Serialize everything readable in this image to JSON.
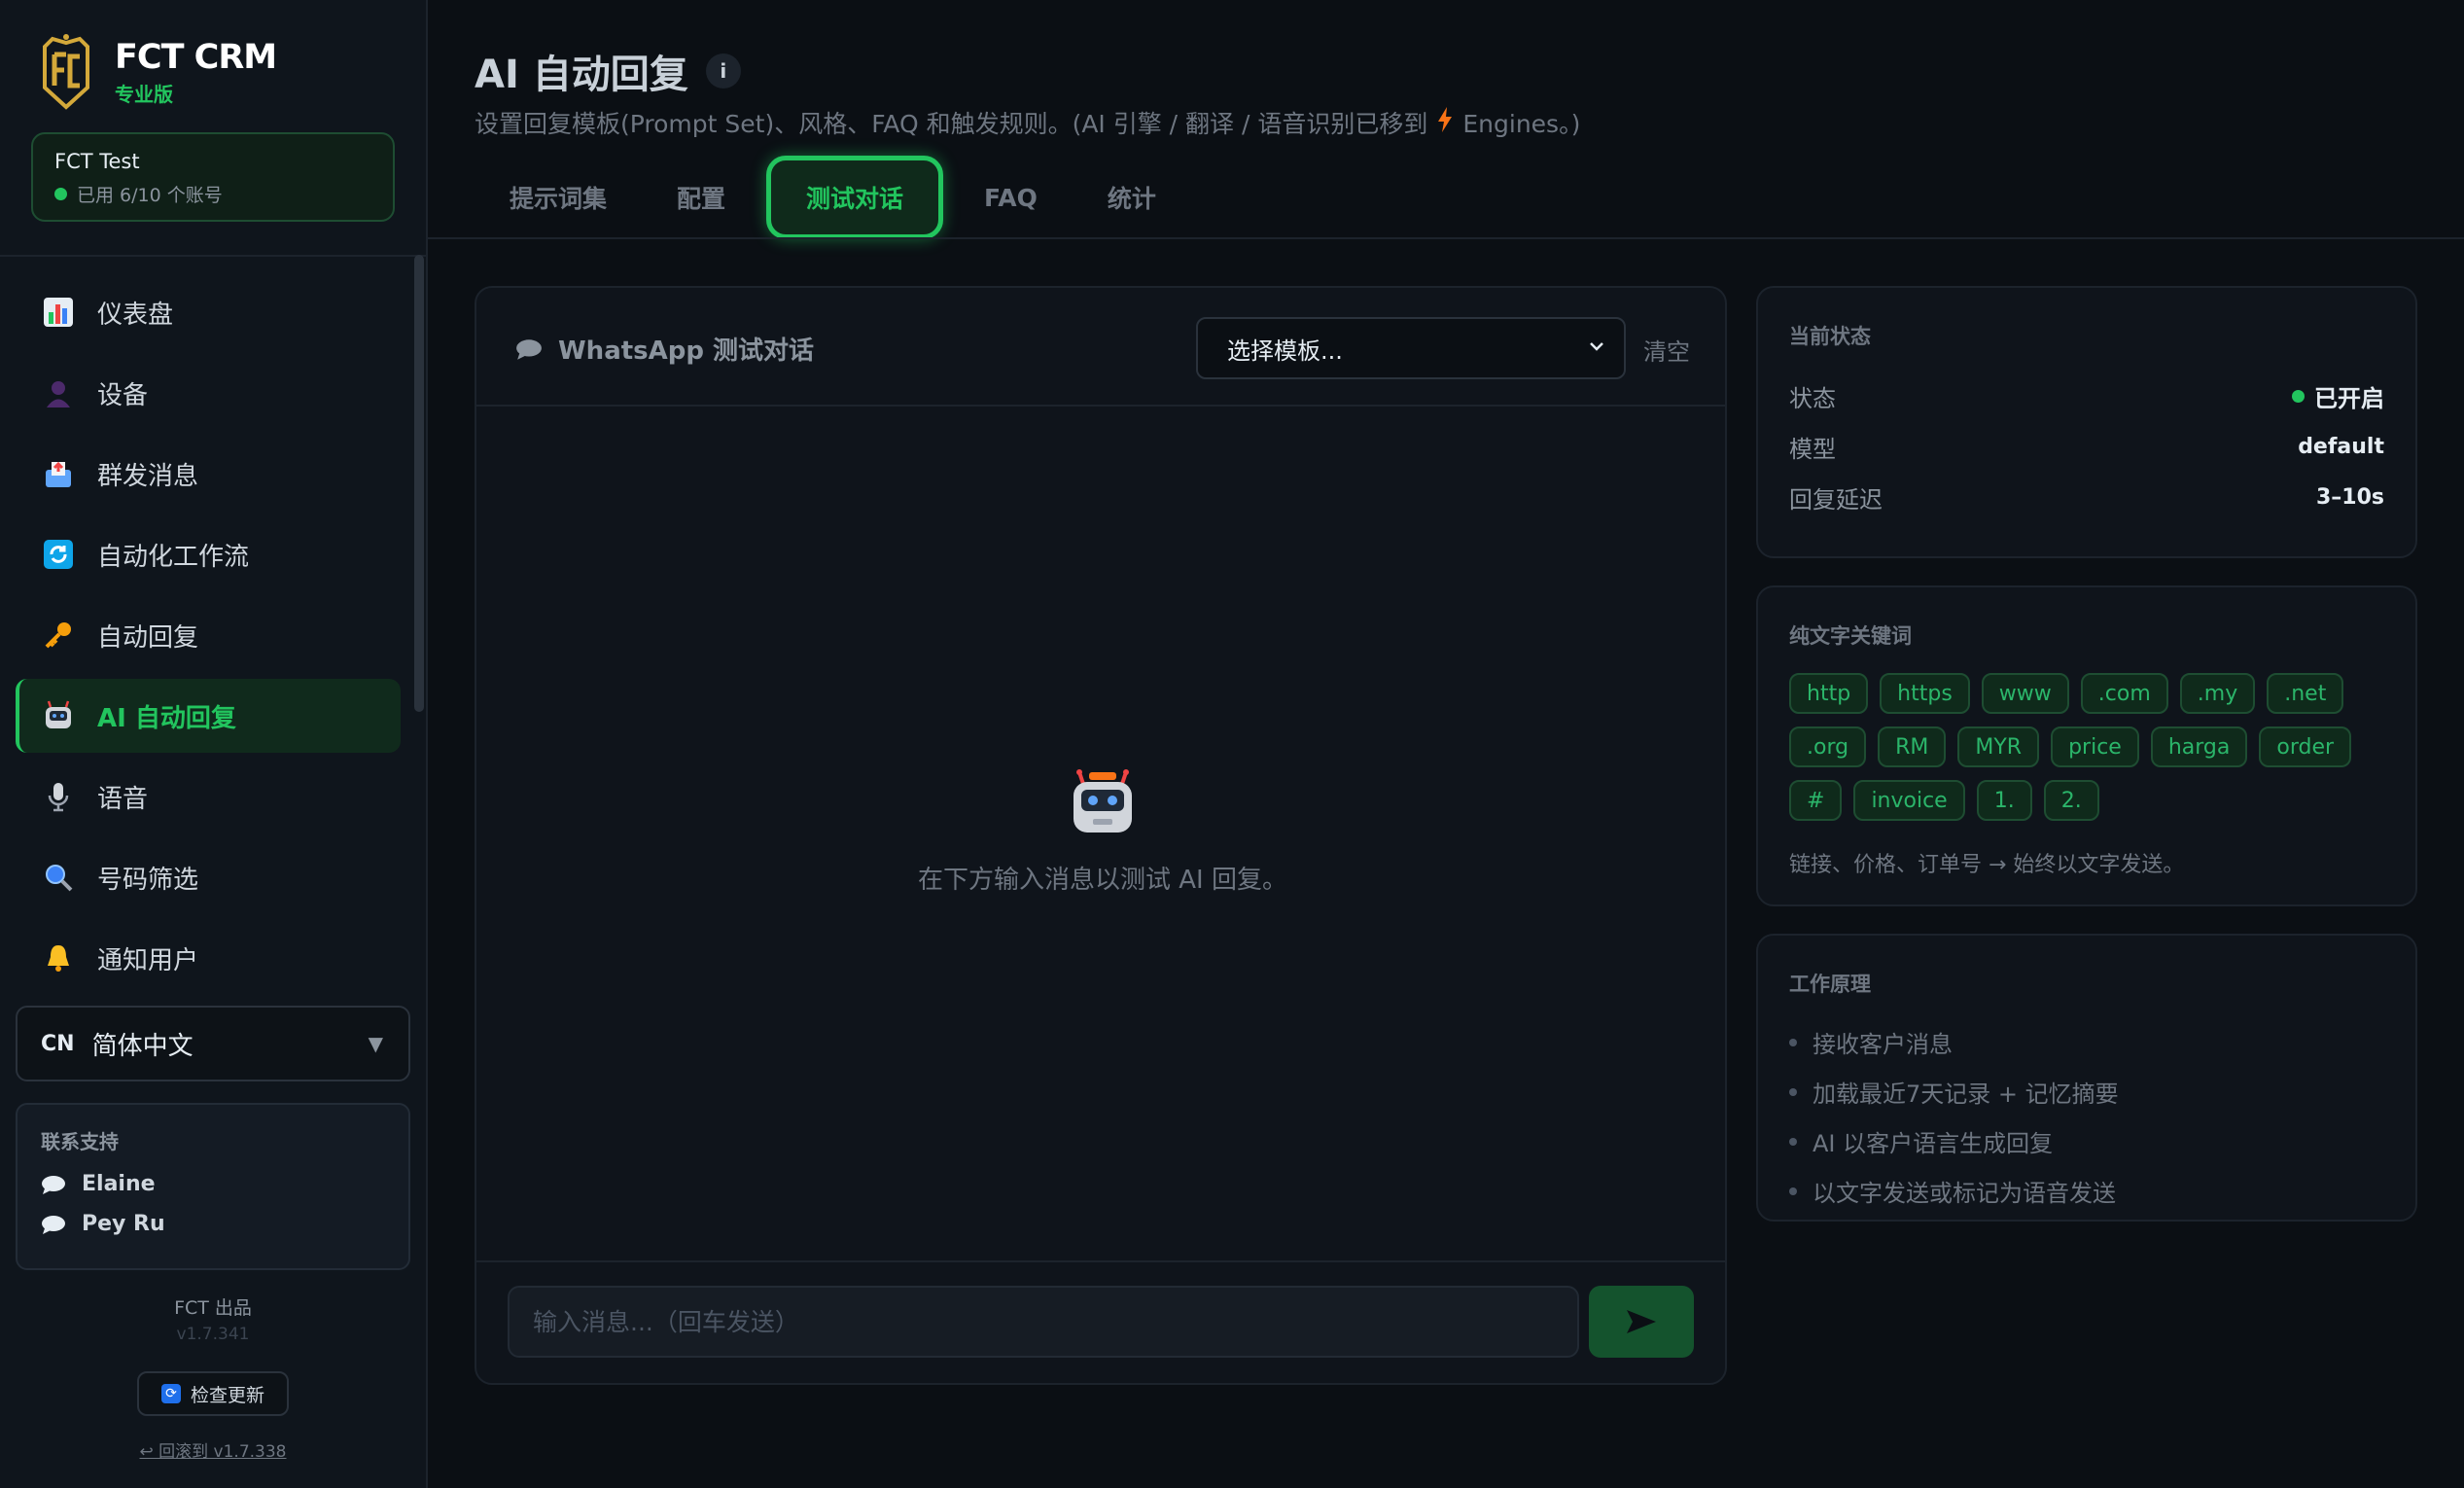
{
  "brand": {
    "name": "FCT CRM",
    "tier": "专业版"
  },
  "account": {
    "name": "FCT Test",
    "usage": "已用 6/10 个账号"
  },
  "nav": {
    "items": [
      {
        "label": "仪表盘",
        "icon": "bar-chart-icon"
      },
      {
        "label": "设备",
        "icon": "person-icon"
      },
      {
        "label": "群发消息",
        "icon": "outbox-icon"
      },
      {
        "label": "自动化工作流",
        "icon": "refresh-icon"
      },
      {
        "label": "自动回复",
        "icon": "key-icon"
      },
      {
        "label": "AI 自动回复",
        "icon": "robot-icon",
        "active": true
      },
      {
        "label": "语音",
        "icon": "microphone-icon"
      },
      {
        "label": "号码筛选",
        "icon": "magnifier-icon"
      },
      {
        "label": "通知用户",
        "icon": "bell-icon"
      }
    ]
  },
  "language": {
    "code": "CN",
    "label": "简体中文"
  },
  "support": {
    "title": "联系支持",
    "contacts": [
      "Elaine",
      "Pey Ru"
    ]
  },
  "footer": {
    "made_by": "FCT 出品",
    "version": "v1.7.341",
    "check_update": "检查更新",
    "rollback": "↩ 回滚到 v1.7.338"
  },
  "page": {
    "title": "AI 自动回复",
    "subtitle_pre": "设置回复模板(Prompt Set)、风格、FAQ 和触发规则。(AI 引擎 / 翻译 / 语音识别已移到",
    "subtitle_post": "Engines。)"
  },
  "tabs": [
    "提示词集",
    "配置",
    "测试对话",
    "FAQ",
    "统计"
  ],
  "active_tab": "测试对话",
  "chat": {
    "title": "WhatsApp 测试对话",
    "template_select": "选择模板...",
    "clear": "清空",
    "empty_text": "在下方输入消息以测试 AI 回复。",
    "input_placeholder": "输入消息...（回车发送）"
  },
  "status_card": {
    "title": "当前状态",
    "rows": [
      {
        "label": "状态",
        "value": "已开启"
      },
      {
        "label": "模型",
        "value": "default"
      },
      {
        "label": "回复延迟",
        "value": "3–10s"
      }
    ]
  },
  "keywords_card": {
    "title": "纯文字关键词",
    "chips": [
      "http",
      "https",
      "www",
      ".com",
      ".my",
      ".net",
      ".org",
      "RM",
      "MYR",
      "price",
      "harga",
      "order",
      "#",
      "invoice",
      "1.",
      "2."
    ],
    "note": "链接、价格、订单号 → 始终以文字发送。"
  },
  "how_card": {
    "title": "工作原理",
    "steps": [
      "接收客户消息",
      "加载最近7天记录 + 记忆摘要",
      "AI 以客户语言生成回复",
      "以文字发送或标记为语音发送"
    ]
  },
  "colors": {
    "accent": "#22c55e",
    "background": "#0b0f14",
    "panel": "#0f141b",
    "bolt": "#f97316"
  }
}
